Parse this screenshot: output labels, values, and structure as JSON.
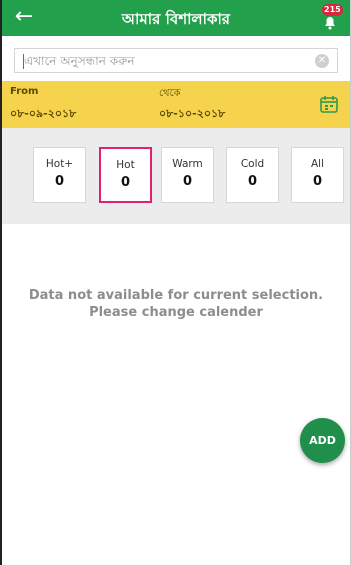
{
  "colors": {
    "appbar": "#23a04b",
    "date_bar": "#f6d34c",
    "active_chip_border": "#e0216e",
    "fab": "#1f8f4b",
    "badge": "#d7263d"
  },
  "appbar": {
    "back_icon": "arrow-left-icon",
    "title": "আমার বিশালাকার",
    "notification_icon": "bell-icon",
    "badge": "215"
  },
  "search": {
    "placeholder": "এখানে অনুসন্ধান করুন",
    "value": "",
    "clear_icon": "clear-icon"
  },
  "date_range": {
    "from_label": "From",
    "from_date": "০৮-০৯-২০১৮",
    "to_label": "থেকে",
    "to_date": "০৮-১০-২০১৮",
    "calendar_icon": "calendar-icon"
  },
  "filters": [
    {
      "label": "Hot+",
      "count": "0",
      "active": false
    },
    {
      "label": "Hot",
      "count": "0",
      "active": true
    },
    {
      "label": "Warm",
      "count": "0",
      "active": false
    },
    {
      "label": "Cold",
      "count": "0",
      "active": false
    },
    {
      "label": "All",
      "count": "0",
      "active": false
    }
  ],
  "empty_state": {
    "line1": "Data not available for current selection.",
    "line2": "Please change calender"
  },
  "fab": {
    "label": "ADD"
  }
}
